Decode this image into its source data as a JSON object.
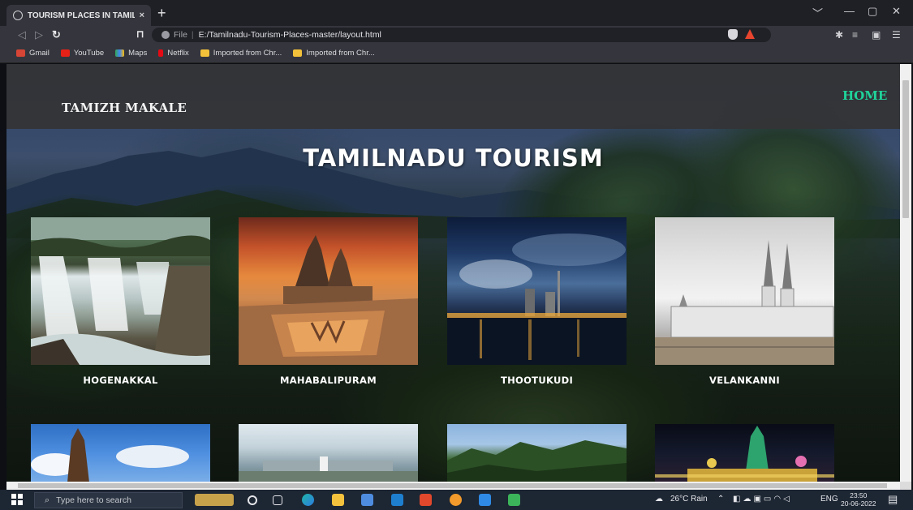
{
  "browser": {
    "tab_title": "TOURISM PLACES IN TAMILNADU",
    "tab_close": "×",
    "new_tab": "+",
    "window_controls": {
      "minimize": "—",
      "maximize": "▢",
      "close": "✕",
      "menu": "﹀"
    },
    "address_prefix": "File",
    "url": "E:/Tamilnadu-Tourism-Places-master/layout.html",
    "bookmarks": [
      {
        "label": "Gmail",
        "color": "#d64535"
      },
      {
        "label": "YouTube",
        "color": "#e62117"
      },
      {
        "label": "Maps",
        "color": "#34a853"
      },
      {
        "label": "Netflix",
        "color": "#e50914"
      },
      {
        "label": "Imported from Chr...",
        "color": "#f3c23a"
      },
      {
        "label": "Imported from Chr...",
        "color": "#f3c23a"
      }
    ]
  },
  "site": {
    "brand": "TAMIZH MAKALE",
    "nav_home": "HOME",
    "hero_title": "TAMILNADU TOURISM",
    "accent_color": "#1fd49a",
    "places": [
      {
        "name": "HOGENAKKAL"
      },
      {
        "name": "MAHABALIPURAM"
      },
      {
        "name": "THOOTUKUDI"
      },
      {
        "name": "VELANKANNI"
      }
    ]
  },
  "taskbar": {
    "search_placeholder": "Type here to search",
    "weather": "26°C Rain",
    "language": "ENG",
    "time": "23:50",
    "date": "20-06-2022"
  }
}
